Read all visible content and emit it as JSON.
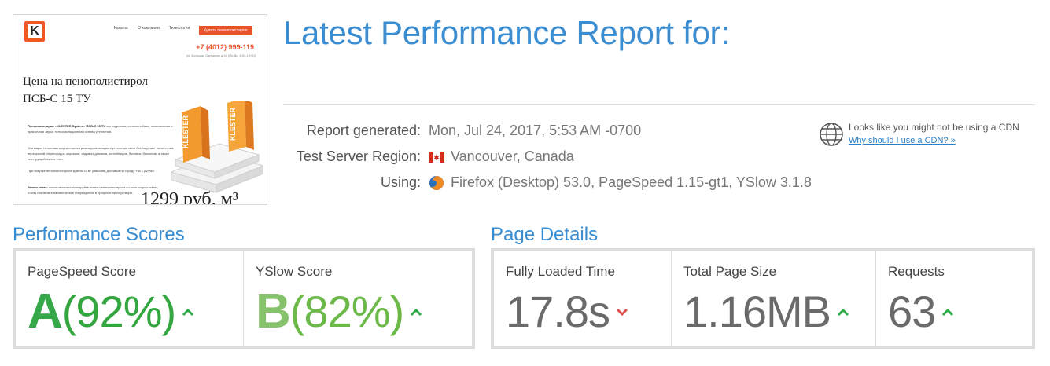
{
  "thumbnail": {
    "logo_letter": "K",
    "nav": [
      "Каталог",
      "О компании",
      "Технология"
    ],
    "nav_cta": "Купить пенополистирол",
    "phone": "+7 (4012) 999-119",
    "address": "ул. Большая Окружная д.1б (Пн-Вс: 8:00-19:00)",
    "heading_line1": "Цена на пенополистирол",
    "heading_line2": "ПСБ-С 15 ТУ",
    "para1_bold": "Пенополистирол «KLESTER System» ПСБ-С 15 ТУ",
    "para1": " это надежная, износостойкая, экономичная и практичная звуко- теплоизоляционная основа утепления.",
    "para2": "Эта марка пенопласта применяется для звукоизоляции и утепления мест без нагрузки: потолочных перекрытий, перегородок, каркасов, садовых домиков, контейнеров, бытовок, балконов, а также конструкций полых стен.",
    "para3": "При покупке пенополистирола кратно 37 м³ (машина) доставка по городу «за 1 рубль».",
    "para4_bold": "Важно знать:",
    "para4": " после монтажа изолируйте плиты пенополистирола со всех сторон стены, чтобы исключить механические повреждения в процессе эксплуатации.",
    "product_brand": "KLESTER",
    "price": "1299 руб. м³"
  },
  "header": {
    "title": "Latest Performance Report for:"
  },
  "meta": {
    "report_label": "Report generated:",
    "report_value": "Mon, Jul 24, 2017, 5:53 AM -0700",
    "region_label": "Test Server Region:",
    "region_value": "Vancouver, Canada",
    "using_label": "Using:",
    "using_value": "Firefox (Desktop) 53.0, PageSpeed 1.15-gt1, YSlow 3.1.8"
  },
  "cdn": {
    "text": "Looks like you might not be using a CDN",
    "link": "Why should I use a CDN? »",
    "icon": "globe-icon"
  },
  "performance": {
    "title": "Performance Scores",
    "pagespeed_label": "PageSpeed Score",
    "pagespeed_grade": "A",
    "pagespeed_pct": "(92%)",
    "pagespeed_trend": "up",
    "yslow_label": "YSlow Score",
    "yslow_grade": "B",
    "yslow_pct": "(82%)",
    "yslow_trend": "up"
  },
  "details": {
    "title": "Page Details",
    "load_label": "Fully Loaded Time",
    "load_value": "17.8s",
    "load_trend": "down",
    "size_label": "Total Page Size",
    "size_value": "1.16MB",
    "size_trend": "up",
    "requests_label": "Requests",
    "requests_value": "63",
    "requests_trend": "up"
  },
  "colors": {
    "brand_blue": "#3a8dd0",
    "grade_a": "#35a84a",
    "grade_b": "#85c26b",
    "trend_up": "#2faa4a",
    "trend_down": "#d9534f"
  }
}
